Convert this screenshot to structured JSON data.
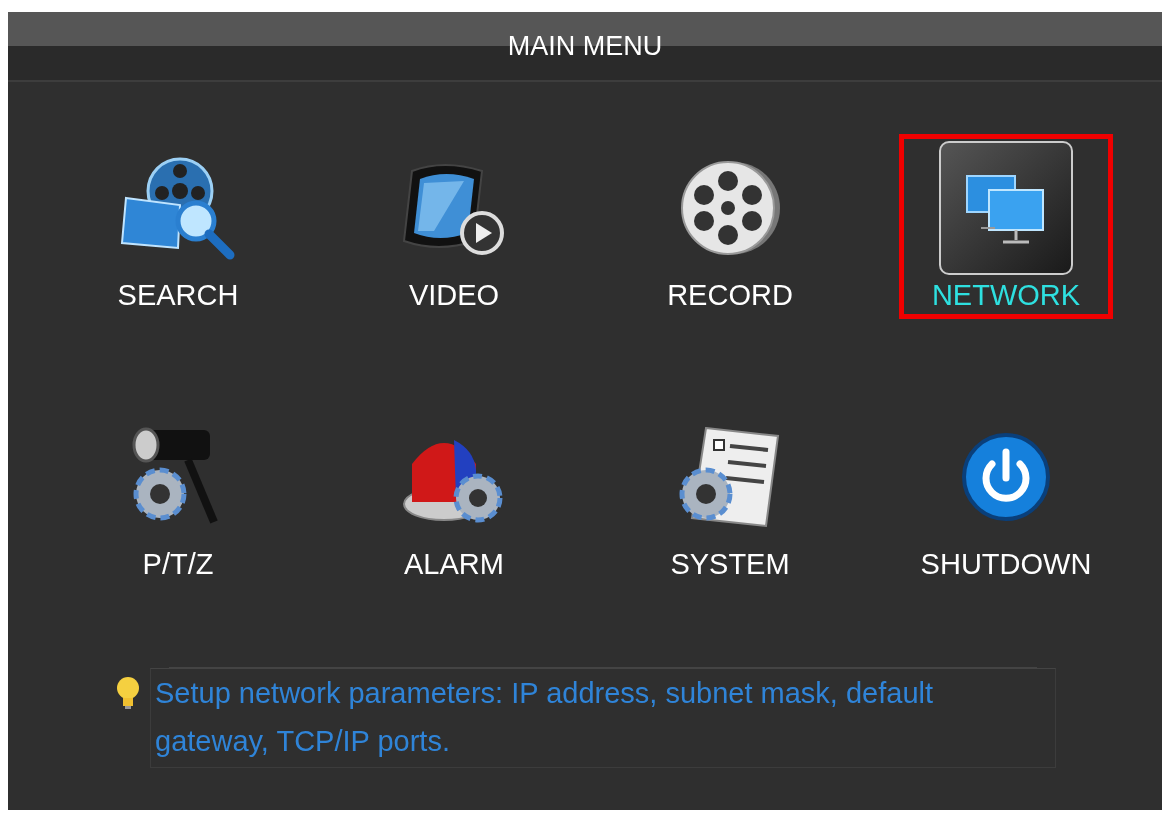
{
  "window": {
    "title": "MAIN MENU"
  },
  "menu_items": [
    {
      "label": "SEARCH",
      "kind": "search",
      "selected": false
    },
    {
      "label": "VIDEO",
      "kind": "video",
      "selected": false
    },
    {
      "label": "RECORD",
      "kind": "record",
      "selected": false
    },
    {
      "label": "NETWORK",
      "kind": "network",
      "selected": true
    },
    {
      "label": "P/T/Z",
      "kind": "ptz",
      "selected": false
    },
    {
      "label": "ALARM",
      "kind": "alarm",
      "selected": false
    },
    {
      "label": "SYSTEM",
      "kind": "system",
      "selected": false
    },
    {
      "label": "SHUTDOWN",
      "kind": "shutdown",
      "selected": false
    }
  ],
  "hint": {
    "text": "Setup network parameters: IP address, subnet mask, default gateway, TCP/IP ports."
  }
}
